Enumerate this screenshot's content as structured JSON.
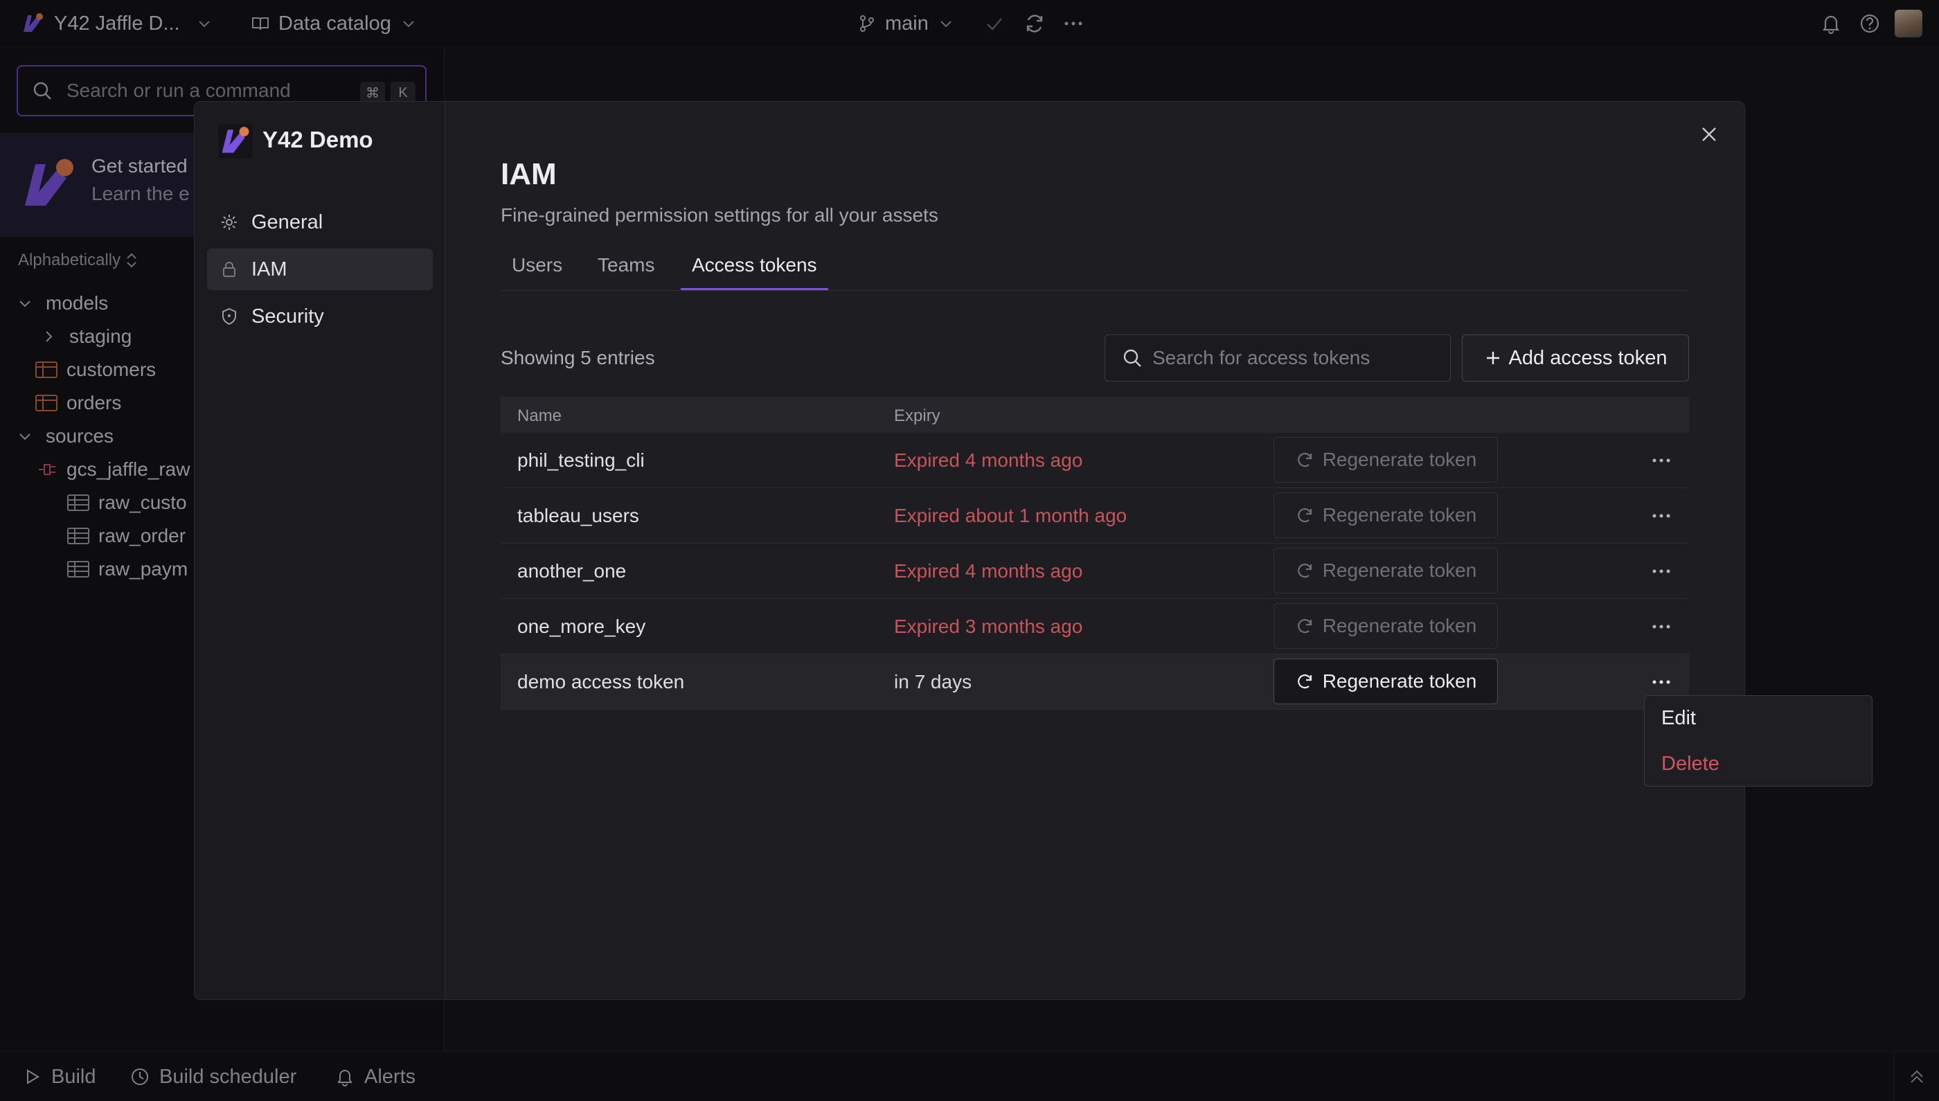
{
  "topbar": {
    "project": "Y42 Jaffle D...",
    "catalog": "Data catalog",
    "branch": "main"
  },
  "sidebar": {
    "search_placeholder": "Search or run a command",
    "shortcut_cmd": "⌘",
    "shortcut_key": "K",
    "get_started_title": "Get started",
    "get_started_sub": "Learn the e",
    "sort_label": "Alphabetically",
    "tree": {
      "models": "models",
      "staging": "staging",
      "customers": "customers",
      "orders": "orders",
      "sources": "sources",
      "gcs": "gcs_jaffle_raw",
      "raw_customers": "raw_custo",
      "raw_orders": "raw_order",
      "raw_payments": "raw_paym"
    }
  },
  "modal": {
    "org_name": "Y42 Demo",
    "nav": {
      "general": "General",
      "iam": "IAM",
      "security": "Security"
    },
    "title": "IAM",
    "subtitle": "Fine-grained permission settings for all your assets",
    "tabs": {
      "users": "Users",
      "teams": "Teams",
      "tokens": "Access tokens"
    },
    "entry_count": "Showing 5 entries",
    "search_placeholder": "Search for access tokens",
    "add_label": "Add access token",
    "columns": {
      "name": "Name",
      "expiry": "Expiry"
    },
    "regenerate_label": "Regenerate token",
    "rows": [
      {
        "name": "phil_testing_cli",
        "expiry": "Expired 4 months ago"
      },
      {
        "name": "tableau_users",
        "expiry": "Expired about 1 month ago"
      },
      {
        "name": "another_one",
        "expiry": "Expired 4 months ago"
      },
      {
        "name": "one_more_key",
        "expiry": "Expired 3 months ago"
      },
      {
        "name": "demo access token",
        "expiry": "in 7 days"
      }
    ],
    "context_menu": {
      "edit": "Edit",
      "delete": "Delete"
    }
  },
  "bottombar": {
    "build": "Build",
    "scheduler": "Build scheduler",
    "alerts": "Alerts"
  },
  "colors": {
    "accent": "#7a52e0",
    "danger": "#c8545b",
    "logo_orange": "#e07a4a"
  }
}
